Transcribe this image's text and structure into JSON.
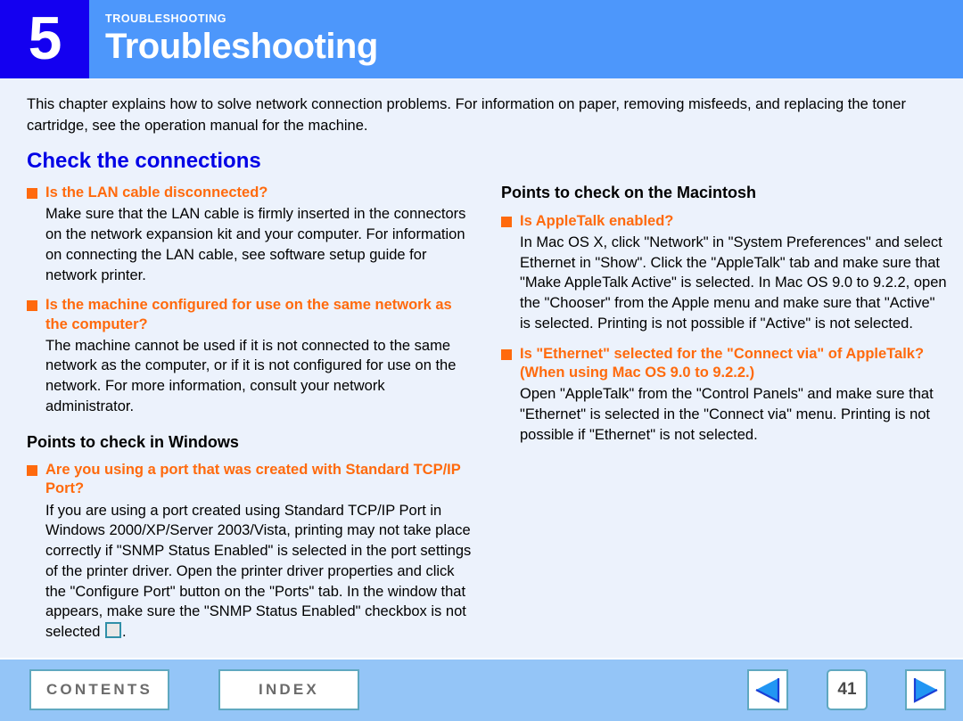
{
  "header": {
    "chapter_number": "5",
    "eyebrow": "TROUBLESHOOTING",
    "title": "Troubleshooting",
    "block_color": "#1400f0",
    "band_color": "#4d97fb"
  },
  "intro": "This chapter explains how to solve network connection problems. For information on paper, removing misfeeds, and replacing the toner cartridge, see the operation manual for the machine.",
  "section_title": "Check the connections",
  "accent_colors": {
    "section_blue": "#0000e6",
    "question_orange": "#ff6a0d",
    "footer_blue": "#94c5f7",
    "page_background": "#ecf2fc"
  },
  "left_column": {
    "blocks": [
      {
        "question": "Is the LAN cable disconnected?",
        "answer": "Make sure that the LAN cable is firmly inserted in the connectors on the network expansion kit and your computer. For information on connecting the LAN cable, see software setup guide for network printer."
      },
      {
        "question": "Is the machine configured for use on the same network as the computer?",
        "answer": "The machine cannot be used if it is not connected to the same network as the computer, or if it is not configured for use on the network. For more information, consult your network administrator."
      }
    ],
    "windows_heading": "Points to check in Windows",
    "windows_block": {
      "question": "Are you using a port that was created with Standard TCP/IP Port?",
      "answer_before_checkbox": "If you are using a port created using Standard TCP/IP Port in Windows 2000/XP/Server 2003/Vista, printing may not take place correctly if \"SNMP Status Enabled\" is selected in the port settings of the printer driver. Open the printer driver properties and click the \"Configure Port\" button on the \"Ports\" tab. In the window that appears, make sure the \"SNMP Status Enabled\" checkbox is not selected ",
      "checkbox_icon": "empty-checkbox-icon",
      "answer_after_checkbox": "."
    }
  },
  "right_column": {
    "macintosh_heading": "Points to check on the Macintosh",
    "blocks": [
      {
        "question": "Is AppleTalk enabled?",
        "answer": "In Mac OS X, click \"Network\" in \"System Preferences\" and select Ethernet in \"Show\". Click the \"AppleTalk\" tab and make sure that \"Make AppleTalk Active\" is selected. In Mac OS 9.0 to 9.2.2, open the \"Chooser\" from the Apple menu and make sure that \"Active\" is selected. Printing is not possible if \"Active\" is not selected."
      },
      {
        "question": "Is \"Ethernet\" selected for the \"Connect via\" of AppleTalk? (When using Mac OS 9.0 to 9.2.2.)",
        "answer": "Open \"AppleTalk\" from the \"Control Panels\" and make sure that \"Ethernet\" is selected in the \"Connect via\" menu. Printing is not possible if \"Ethernet\" is not selected."
      }
    ]
  },
  "footer": {
    "contents_label": "CONTENTS",
    "index_label": "INDEX",
    "page_number": "41",
    "prev_icon": "left-triangle-icon",
    "next_icon": "right-triangle-icon"
  }
}
